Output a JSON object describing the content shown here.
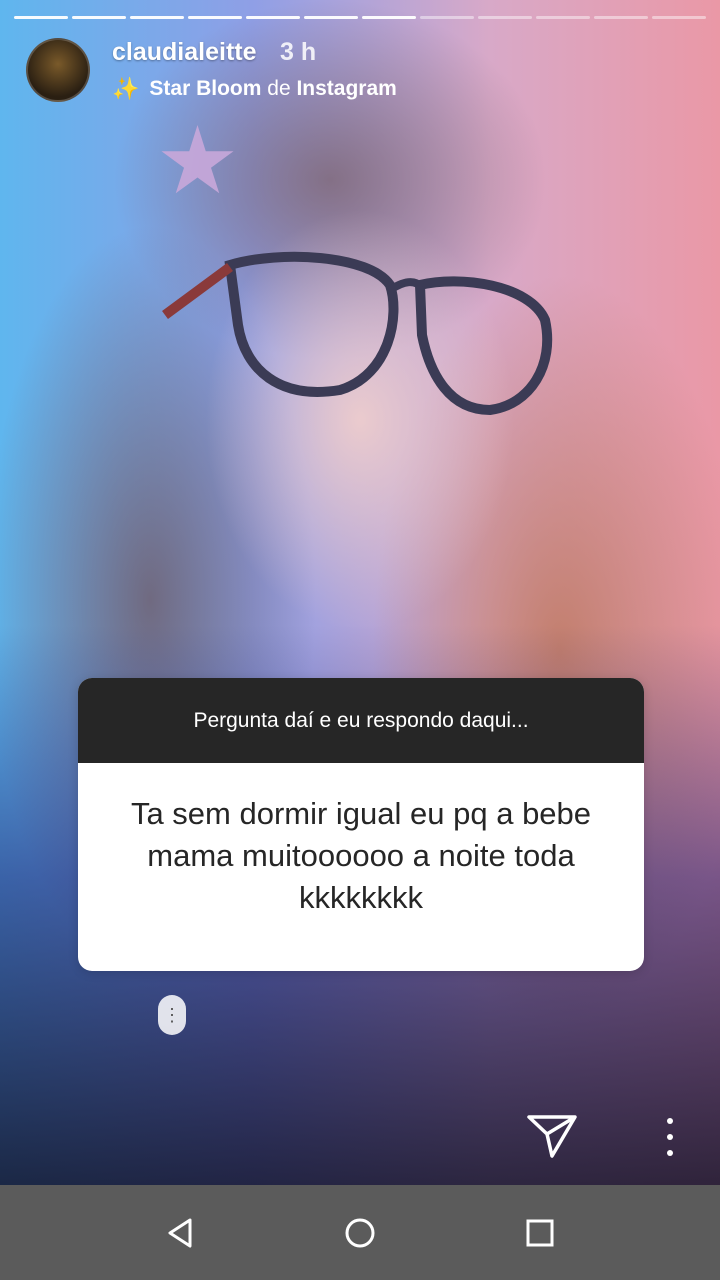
{
  "story": {
    "progress_segments": 12,
    "progress_filled": 7,
    "username": "claudialeitte",
    "time": "3 h",
    "effect": {
      "name": "Star Bloom",
      "connector": "de",
      "source": "Instagram"
    },
    "question_sticker": {
      "prompt": "Pergunta daí e eu respondo daqui...",
      "answer": "Ta sem dormir igual eu pq a bebe mama muitoooooo a noite toda kkkkkkkk"
    }
  },
  "icons": {
    "sparkle": "sparkle-icon",
    "send": "send-icon",
    "more": "more-options-icon",
    "nav_back": "back-icon",
    "nav_home": "home-icon",
    "nav_recents": "recents-icon"
  },
  "colors": {
    "card_header": "#262626",
    "nav_bar": "#5b5b5b"
  }
}
